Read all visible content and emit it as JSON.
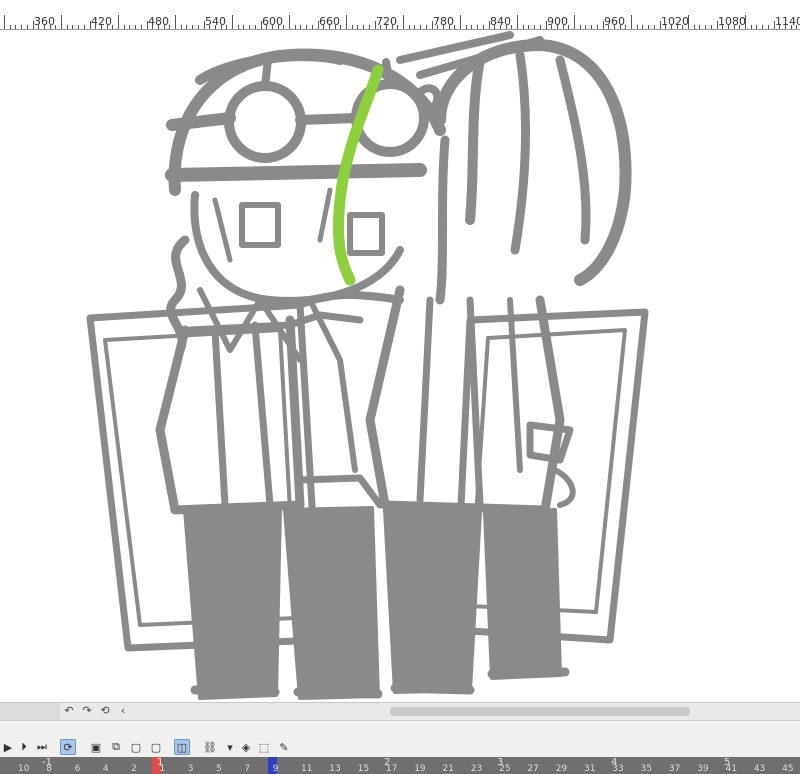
{
  "ruler": {
    "labels": [
      "360",
      "420",
      "480",
      "540",
      "600",
      "660",
      "720",
      "780",
      "840",
      "900",
      "960",
      "1020",
      "1080",
      "1140"
    ]
  },
  "timeline": {
    "toolbar_icons": [
      "play-icon",
      "step-forward-icon",
      "skip-end-icon",
      "loop-icon",
      "new-cel-icon",
      "duplicate-cel-icon",
      "cel-icon",
      "cel-icon-2",
      "onion-skin-icon",
      "link-icon",
      "dropdown-icon",
      "light-table-icon",
      "cel-shape-icon",
      "pen-icon"
    ],
    "frame_section_labels": [
      "-1",
      "1",
      "2",
      "3",
      "4",
      "5"
    ],
    "frame_numbers": [
      "10",
      "8",
      "6",
      "4",
      "2",
      "1",
      "3",
      "5",
      "7",
      "9",
      "11",
      "13",
      "15",
      "17",
      "19",
      "21",
      "23",
      "25",
      "27",
      "29",
      "31",
      "33",
      "35",
      "37",
      "39",
      "41",
      "43",
      "45"
    ]
  },
  "colors": {
    "accent_green": "#8dcf3c",
    "sketch_gray": "#8a8a8a",
    "frame_red": "#e14d4d",
    "frame_blue": "#2f3fbf"
  }
}
